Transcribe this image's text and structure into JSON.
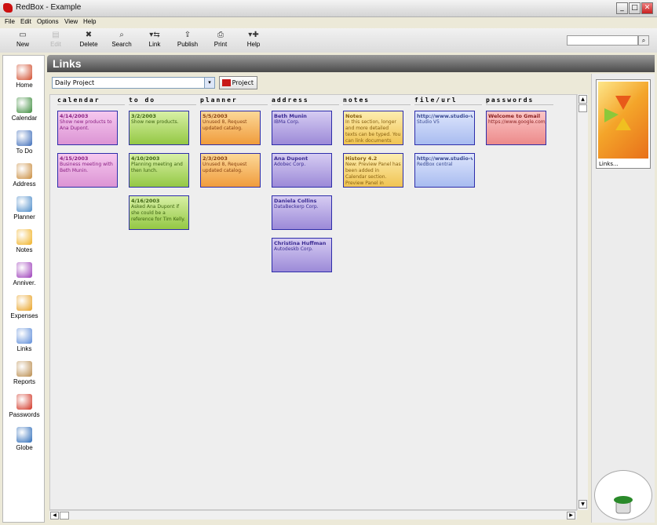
{
  "window": {
    "title": "RedBox - Example",
    "minimize": "_",
    "maximize": "□",
    "close": "✕"
  },
  "menu": [
    "File",
    "Edit",
    "Options",
    "View",
    "Help"
  ],
  "toolbar": [
    {
      "label": "New",
      "icon": "new-icon",
      "glyph": "▭",
      "enabled": true
    },
    {
      "label": "Edit",
      "icon": "edit-icon",
      "glyph": "▤",
      "enabled": false
    },
    {
      "label": "Delete",
      "icon": "delete-icon",
      "glyph": "✖",
      "enabled": true
    },
    {
      "label": "Search",
      "icon": "search-icon",
      "glyph": "⌕",
      "enabled": true
    },
    {
      "label": "Link",
      "icon": "link-icon",
      "glyph": "▾⇆",
      "enabled": true
    },
    {
      "label": "Publish",
      "icon": "publish-icon",
      "glyph": "⇪",
      "enabled": true
    },
    {
      "label": "Print",
      "icon": "print-icon",
      "glyph": "⎙",
      "enabled": true
    },
    {
      "label": "Help",
      "icon": "help-icon",
      "glyph": "▾✚",
      "enabled": true
    }
  ],
  "search": {
    "value": "",
    "button": "⌕"
  },
  "sidebar": [
    {
      "label": "Home",
      "icon": "home-icon",
      "color": "#d04a2a"
    },
    {
      "label": "Calendar",
      "icon": "calendar-icon",
      "color": "#3a8a3a"
    },
    {
      "label": "To Do",
      "icon": "todo-icon",
      "color": "#3a6ab8"
    },
    {
      "label": "Address",
      "icon": "address-icon",
      "color": "#c88a3a"
    },
    {
      "label": "Planner",
      "icon": "planner-icon",
      "color": "#4a8ac8"
    },
    {
      "label": "Notes",
      "icon": "notes-icon",
      "color": "#f0b020"
    },
    {
      "label": "Anniver.",
      "icon": "anniversary-icon",
      "color": "#9a3ab8"
    },
    {
      "label": "Expenses",
      "icon": "expenses-icon",
      "color": "#e8a020"
    },
    {
      "label": "Links",
      "icon": "links-icon",
      "color": "#5a8ad8"
    },
    {
      "label": "Reports",
      "icon": "reports-icon",
      "color": "#b88a4a"
    },
    {
      "label": "Passwords",
      "icon": "passwords-icon",
      "color": "#d03020"
    },
    {
      "label": "Globe",
      "icon": "globe-icon",
      "color": "#2a6ab8"
    }
  ],
  "page": {
    "title": "Links"
  },
  "project": {
    "selected": "Daily Project",
    "dropdown_arrow": "▾",
    "button_label": "Project"
  },
  "columns": [
    {
      "title": "calendar",
      "cards": [
        {
          "title": "4/14/2003",
          "body": "Show new products to Ana Dupont.",
          "color": "pink"
        },
        {
          "title": "4/15/2003",
          "body": "Business meeting with Beth Munin.",
          "color": "pink"
        }
      ]
    },
    {
      "title": "to do",
      "cards": [
        {
          "title": "3/2/2003",
          "body": "Show new products.",
          "color": "green"
        },
        {
          "title": "4/10/2003",
          "body": "Planning meeting and then lunch.",
          "color": "green"
        },
        {
          "title": "4/16/2003",
          "body": "Asked Ana Dupont if she could be a reference for Tim Kelly.",
          "color": "green"
        }
      ]
    },
    {
      "title": "planner",
      "cards": [
        {
          "title": "5/5/2003",
          "body": "Unused 8, Request updated catalog.",
          "color": "orange"
        },
        {
          "title": "2/3/2003",
          "body": "Unused 8, Request updated catalog.",
          "color": "orange"
        }
      ]
    },
    {
      "title": "address",
      "cards": [
        {
          "title": "Beth Munin",
          "body": "IBMa Corp.",
          "color": "purple"
        },
        {
          "title": "Ana Dupont",
          "body": "Adobec Corp.",
          "color": "purple"
        },
        {
          "title": "Daniela Collins",
          "body": "DataBeckerp Corp.",
          "color": "purple"
        },
        {
          "title": "Christina Huffman",
          "body": "Autodeskb Corp.",
          "color": "purple"
        }
      ]
    },
    {
      "title": "notes",
      "cards": [
        {
          "title": "Notes",
          "body": "In this section, longer and more detailed texts can be typed. You can link documents from Notes",
          "color": "yellow"
        },
        {
          "title": "History 4.2",
          "body": "New: Preview Panel has been added in Calendar section. Preview Panel in Calendar selection allows",
          "color": "yellow"
        }
      ]
    },
    {
      "title": "file/url",
      "cards": [
        {
          "title": "http://www.studio-v...",
          "body": "Studio V5",
          "color": "blue"
        },
        {
          "title": "http://www.studio-v...",
          "body": "RedBox central",
          "color": "blue"
        }
      ]
    },
    {
      "title": "passwords",
      "cards": [
        {
          "title": "Welcome to Gmail",
          "body": "https://www.google.com/a",
          "color": "red"
        }
      ]
    }
  ],
  "preview": {
    "label": "Links..."
  }
}
